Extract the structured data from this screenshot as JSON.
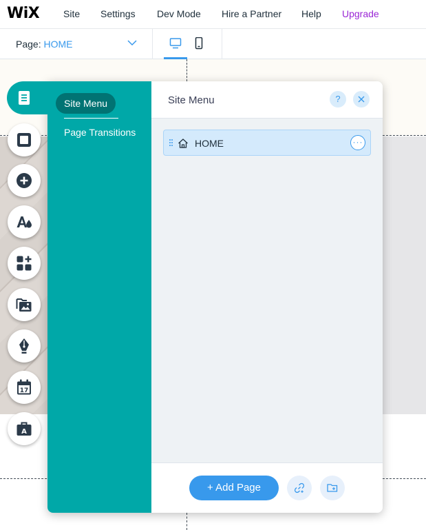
{
  "app": {
    "logo": "WiX"
  },
  "top_menu": {
    "site": "Site",
    "settings": "Settings",
    "dev_mode": "Dev Mode",
    "hire_partner": "Hire a Partner",
    "help": "Help",
    "upgrade": "Upgrade"
  },
  "page_selector": {
    "label": "Page:",
    "value": "HOME"
  },
  "device_toggle": {
    "options": [
      "desktop-icon",
      "mobile-icon"
    ],
    "active": "desktop-icon"
  },
  "left_rail": {
    "active": "pages-icon",
    "icons": [
      "pages-icon",
      "background-icon",
      "add-icon",
      "theme-icon",
      "add-apps-icon",
      "media-icon",
      "blog-pen-icon",
      "bookings-calendar-icon",
      "business-briefcase-icon"
    ],
    "calendar_day": "17",
    "briefcase_letter": "A"
  },
  "panel": {
    "tabs": [
      "Site Menu",
      "Page Transitions"
    ],
    "active_tab": "Site Menu",
    "title": "Site Menu",
    "help_symbol": "?",
    "pages": [
      {
        "label": "HOME",
        "icon": "home-icon",
        "selected": true
      }
    ],
    "more_symbol": "···",
    "add_page_label": "+ Add Page",
    "footer_icons": [
      "link-icon",
      "folder-add-icon"
    ]
  },
  "colors": {
    "panel_side": "#00a8a8",
    "active_tab_bg": "#017373",
    "accent_blue": "#3899ec",
    "upgrade_purple": "#9a27d5",
    "selected_row": "#d4eafc"
  }
}
